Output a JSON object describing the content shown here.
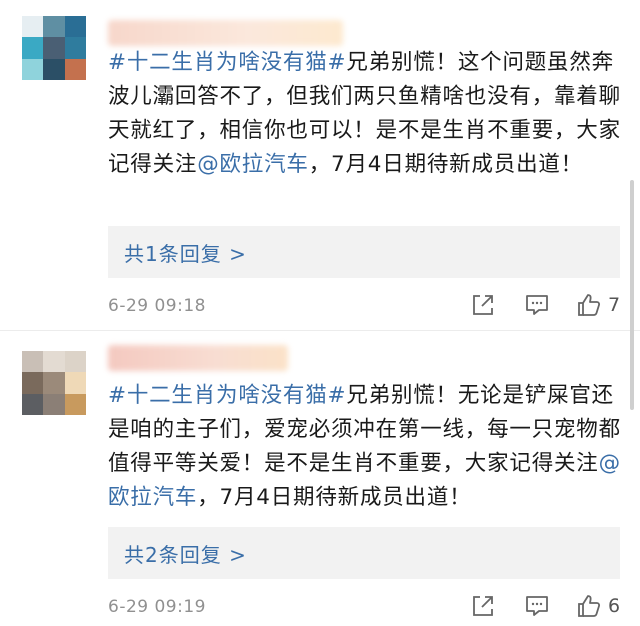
{
  "comments": [
    {
      "topic": "#十二生肖为啥没有猫#",
      "text_a": "兄弟别慌！这个问题虽然奔波儿灞回答不了，但我们两只鱼精啥也没有，靠着聊天就红了，相信你也可以！是不是生肖不重要，大家记得关注",
      "mention": "@欧拉汽车",
      "text_b": "，7月4日期待新成员出道！",
      "replies": "共1条回复 >",
      "timestamp": "6-29 09:18",
      "likes": "7"
    },
    {
      "topic": "#十二生肖为啥没有猫#",
      "text_a": "兄弟别慌！无论是铲屎官还是咱的主子们，爱宠必须冲在第一线，每一只宠物都值得平等关爱！是不是生肖不重要，大家记得关注",
      "mention": "@欧拉汽车",
      "text_b": "，7月4日期待新成员出道！",
      "replies": "共2条回复 >",
      "timestamp": "6-29 09:19",
      "likes": "6"
    }
  ],
  "icons": {
    "share": "share-icon",
    "reply": "comment-icon",
    "like": "thumbs-up-icon"
  },
  "colors": {
    "link": "#3a6ea8",
    "meta": "#909090",
    "reply_bg": "#f2f2f2"
  }
}
